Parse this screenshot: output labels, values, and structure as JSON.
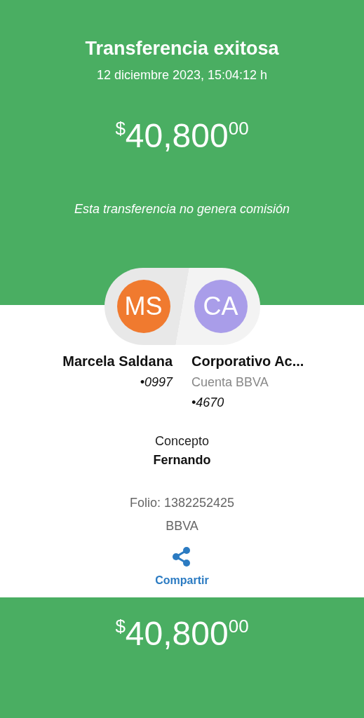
{
  "header": {
    "title": "Transferencia exitosa",
    "datetime": "12 diciembre 2023, 15:04:12 h",
    "amount": {
      "currency": "$",
      "integer": "40,800",
      "cents": "00"
    },
    "note": "Esta transferencia no genera comisión"
  },
  "parties": [
    {
      "initials": "MS",
      "color": "#f07a2f",
      "name": "Marcela Saldana",
      "account": "•0997"
    },
    {
      "initials": "CA",
      "color": "#a99de9",
      "name": "Corporativo Ac...",
      "bank": "Cuenta BBVA",
      "account": "•4670"
    }
  ],
  "concept": {
    "label": "Concepto",
    "value": "Fernando"
  },
  "folio": "Folio: 1382252425",
  "bank": "BBVA",
  "share_button": {
    "label": "Compartir"
  },
  "footer": {
    "amount": {
      "currency": "$",
      "integer": "40,800",
      "cents": "00"
    }
  }
}
